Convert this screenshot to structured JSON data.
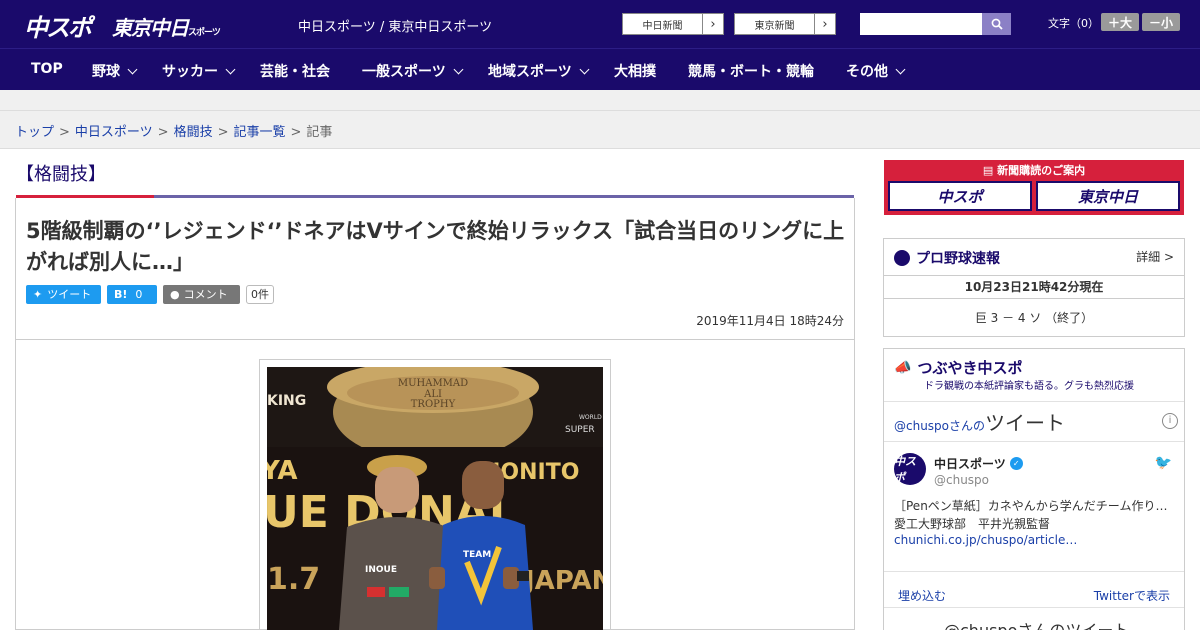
{
  "header": {
    "logo_primary": "中スポ",
    "logo_secondary": "東京中日",
    "logo_secondary_small": "スポーツ",
    "site_links": "中日スポーツ / 東京中日スポーツ",
    "ext_links": [
      {
        "label": "中日新聞"
      },
      {
        "label": "東京新聞"
      }
    ],
    "search_placeholder": "",
    "font_size_label": "文字（0）",
    "font_up": "＋大",
    "font_down": "－小"
  },
  "nav": {
    "items": [
      {
        "label": "TOP",
        "dropdown": false
      },
      {
        "label": "野球",
        "dropdown": true
      },
      {
        "label": "サッカー",
        "dropdown": true
      },
      {
        "label": "芸能・社会",
        "dropdown": false
      },
      {
        "label": "一般スポーツ",
        "dropdown": true
      },
      {
        "label": "地域スポーツ",
        "dropdown": true
      },
      {
        "label": "大相撲",
        "dropdown": false
      },
      {
        "label": "競馬・ボート・競輪",
        "dropdown": false
      },
      {
        "label": "その他",
        "dropdown": true
      }
    ]
  },
  "breadcrumb": {
    "items": [
      "トップ",
      "中日スポーツ",
      "格闘技",
      "記事一覧"
    ],
    "current": "記事",
    "separator": ">"
  },
  "article": {
    "category": "【格闘技】",
    "headline": "5階級制覇の‘’レジェンド‘’ドネアはVサインで終始リラックス「試合当日のリングに上がれば別人に…」",
    "share": {
      "tweet_label": "ツイート",
      "hatena_label": "B!",
      "hatena_count": "0",
      "comment_label": "コメント",
      "comment_count": "0件"
    },
    "published": "2019年11月4日 18時24分",
    "photo_texts": {
      "trophy_line1": "MUHAMMAD",
      "trophy_line2": "ALI",
      "trophy_line3": "TROPHY",
      "left_banner": "KING",
      "right_banner_top": "WORLD",
      "right_banner_bottom": "SUPER",
      "poster_left": "YA",
      "poster_right": "NONITO",
      "poster_mid": "UE DONAI",
      "poster_date": "1.7",
      "poster_japan": "JAPAN",
      "left_shirt": "INOUE",
      "right_shirt": "TEAM"
    }
  },
  "sidebar": {
    "subscription": {
      "title": "新聞購読のご案内",
      "left": "中スポ",
      "right": "東京中日"
    },
    "baseball": {
      "title": "プロ野球速報",
      "more": "詳細 >",
      "updated": "10月23日21時42分現在",
      "score": "巨 3 － 4 ソ （終了）"
    },
    "tweets": {
      "title": "つぶやき中スポ",
      "subtitle": "ドラ観戦の本紙評論家も語る。グラも熱烈応援",
      "widget_handle": "@chuspoさんの",
      "widget_word": "ツイート",
      "account_name": "中日スポーツ",
      "account_handle": "@chuspo",
      "avatar_text": "中スポ",
      "text": "［Penペン草紙］カネやんから学んだチーム作り…　愛工大野球部　平井光親監督",
      "link": "chunichi.co.jp/chuspo/article…",
      "embed": "埋め込む",
      "view_on": "Twitterで表示",
      "next": "@chuspoさんのツイート"
    }
  },
  "colors": {
    "brand": "#1a0a6b",
    "accent_red": "#d6203c",
    "link": "#1a3fa8",
    "twitter": "#1d9bf0"
  }
}
